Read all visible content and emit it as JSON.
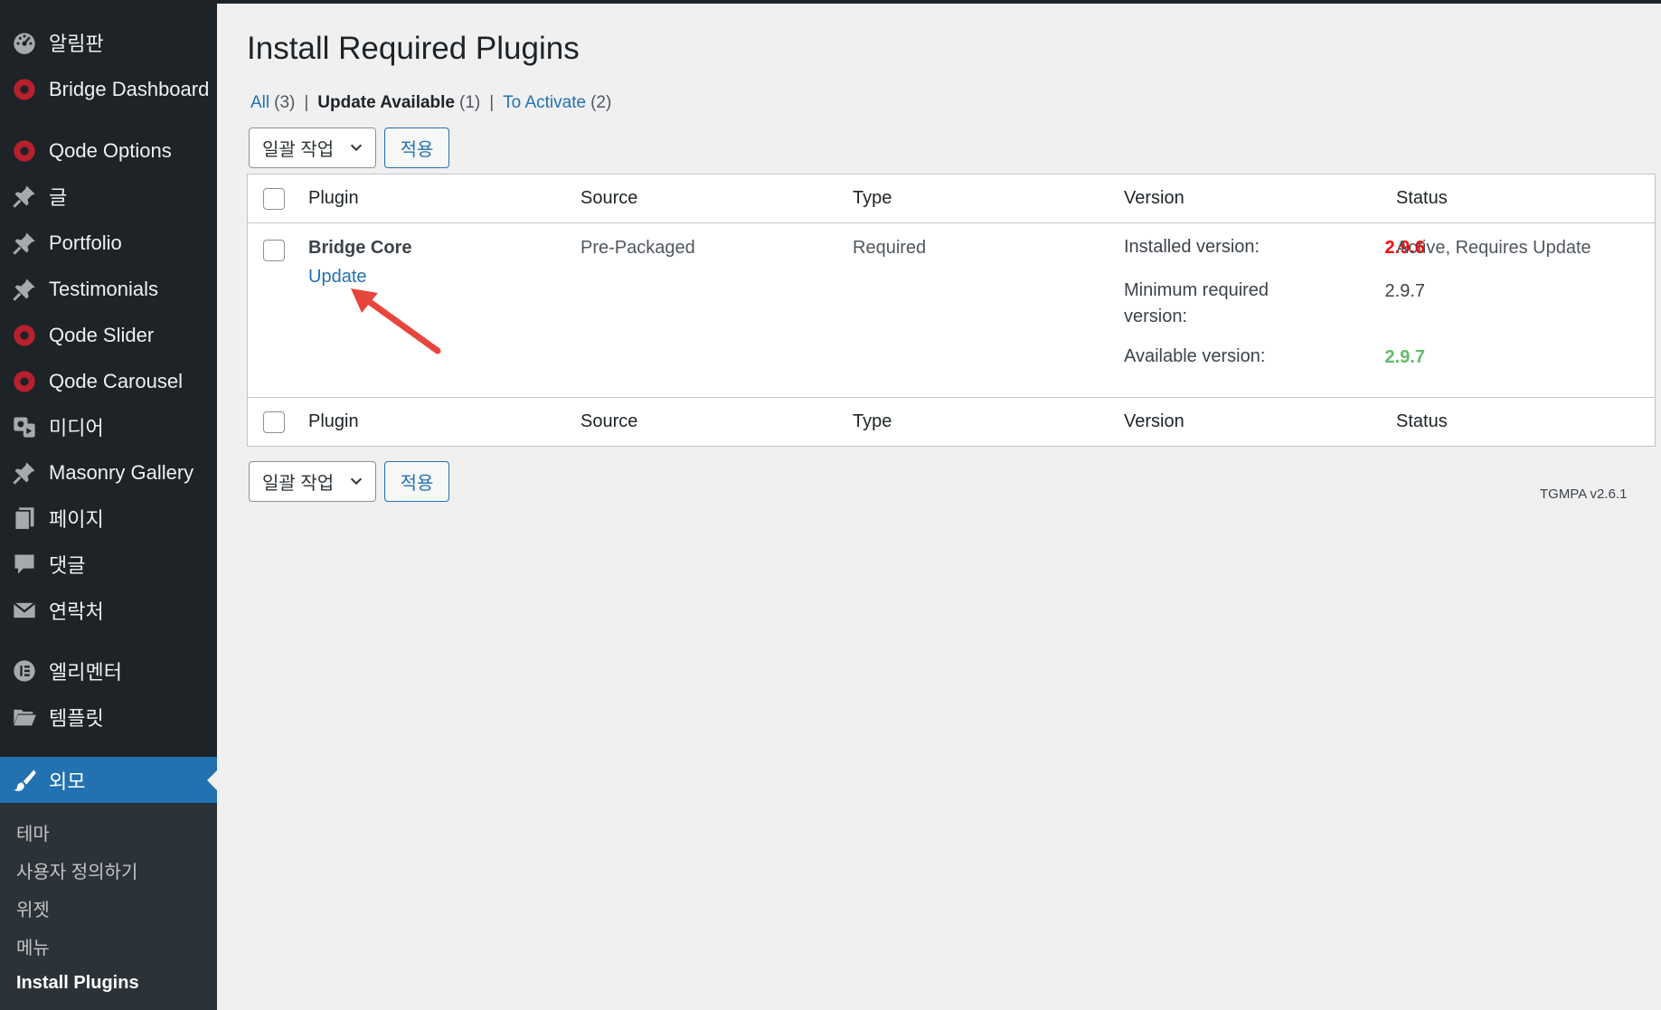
{
  "sidebar": {
    "items": [
      {
        "label": "알림판",
        "icon": "dashboard-gauge-icon"
      },
      {
        "label": "Bridge Dashboard",
        "icon": "qode-circle-icon"
      },
      {
        "label": "Qode Options",
        "icon": "qode-circle-icon"
      },
      {
        "label": "글",
        "icon": "pushpin-icon"
      },
      {
        "label": "Portfolio",
        "icon": "pushpin-icon"
      },
      {
        "label": "Testimonials",
        "icon": "pushpin-icon"
      },
      {
        "label": "Qode Slider",
        "icon": "qode-circle-icon"
      },
      {
        "label": "Qode Carousel",
        "icon": "qode-circle-icon"
      },
      {
        "label": "미디어",
        "icon": "media-icon"
      },
      {
        "label": "Masonry Gallery",
        "icon": "pushpin-icon"
      },
      {
        "label": "페이지",
        "icon": "pages-icon"
      },
      {
        "label": "댓글",
        "icon": "comment-icon"
      },
      {
        "label": "연락처",
        "icon": "envelope-icon"
      },
      {
        "label": "엘리멘터",
        "icon": "elementor-icon"
      },
      {
        "label": "템플릿",
        "icon": "folder-icon"
      },
      {
        "label": "외모",
        "icon": "paintbrush-icon"
      }
    ],
    "submenu": [
      "테마",
      "사용자 정의하기",
      "위젯",
      "메뉴",
      "Install Plugins"
    ]
  },
  "page": {
    "title": "Install Required Plugins",
    "filters": [
      {
        "label": "All",
        "count": "(3)"
      },
      {
        "label": "Update Available",
        "count": "(1)"
      },
      {
        "label": "To Activate",
        "count": "(2)"
      }
    ],
    "bulk_label": "일괄 작업",
    "apply_label": "적용",
    "columns": [
      "Plugin",
      "Source",
      "Type",
      "Version",
      "Status"
    ],
    "row": {
      "plugin": "Bridge Core",
      "action": "Update",
      "source": "Pre-Packaged",
      "type": "Required",
      "installed_label": "Installed version:",
      "installed_value": "2.9.6",
      "min_label_1": "Minimum required",
      "min_label_2": "version:",
      "min_value": "2.9.7",
      "available_label": "Available version:",
      "available_value": "2.9.7",
      "status": "Active, Requires Update"
    },
    "footer_version": "TGMPA v2.6.1"
  },
  "colors": {
    "sidebar_bg": "#1d2327",
    "accent": "#2271b1",
    "qode_red": "#b8202e",
    "installed_red": "#ff0000",
    "available_green": "#66bb6a",
    "annotation_arrow": "#e8453c"
  }
}
